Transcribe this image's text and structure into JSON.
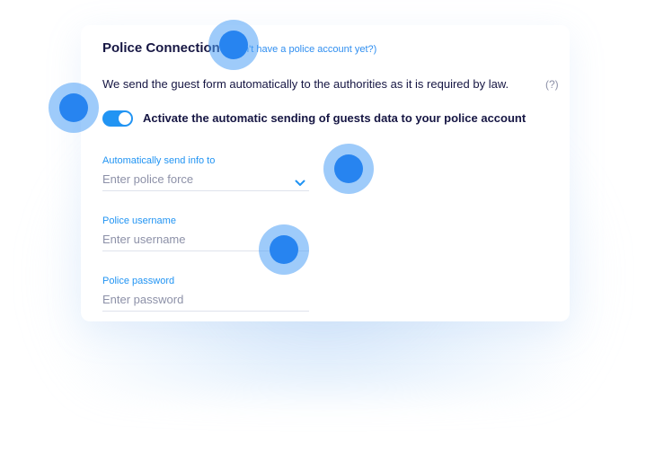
{
  "header": {
    "title": "Police Connection",
    "link": "(Don't have a police account yet?)"
  },
  "description": "We send the guest form automatically to the authorities as it is required by law.",
  "help_label": "(?)",
  "toggle": {
    "label": "Activate the automatic sending of guests data to your police account",
    "state": "on"
  },
  "fields": {
    "police_force": {
      "label": "Automatically send info to",
      "placeholder": "Enter police force",
      "value": ""
    },
    "username": {
      "label": "Police username",
      "placeholder": "Enter username",
      "value": ""
    },
    "password": {
      "label": "Police password",
      "placeholder": "Enter password",
      "value": ""
    }
  },
  "colors": {
    "accent": "#2194f3",
    "text": "#161643",
    "muted": "#8d91a8",
    "hotspot": "#2784f0"
  },
  "icons": {
    "dropdown": "chevron-down-icon",
    "toggle_knob": "toggle-knob-icon",
    "hotspot": "hotspot-dot-icon"
  }
}
